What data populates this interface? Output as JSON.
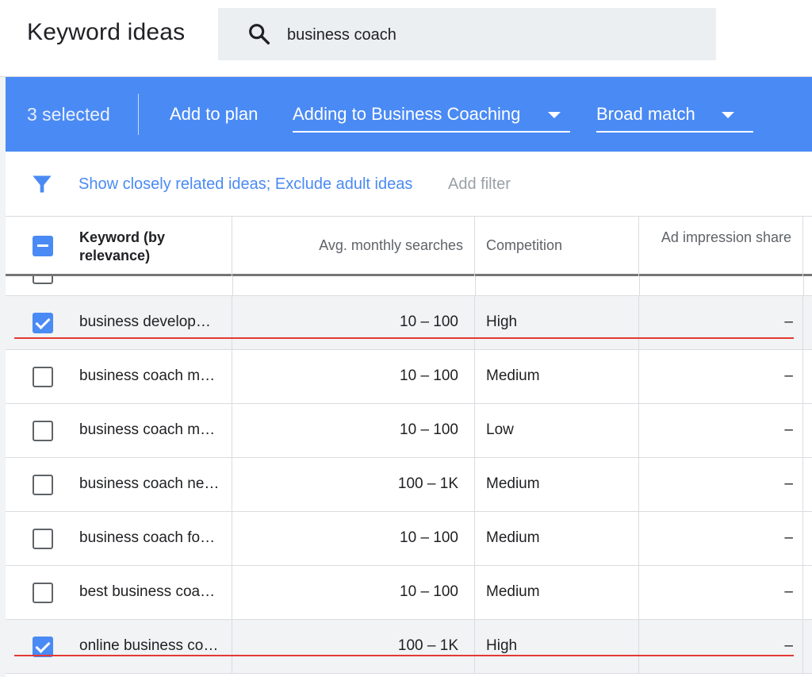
{
  "header": {
    "title": "Keyword ideas",
    "search": {
      "value": "business coach",
      "icon": "search-icon"
    }
  },
  "selection_bar": {
    "count_label": "3 selected",
    "add_to_plan": "Add to plan",
    "plan_dropdown": "Adding to Business Coaching",
    "match_dropdown": "Broad match",
    "background_color": "#4a8af4"
  },
  "filters": {
    "icon": "filter-icon",
    "active_filters": "Show closely related ideas; Exclude adult ideas",
    "add_filter": "Add filter"
  },
  "table": {
    "columns": {
      "keyword": "Keyword (by relevance)",
      "avg_monthly_searches": "Avg. monthly searches",
      "competition": "Competition",
      "ad_impression_share": "Ad impression share"
    },
    "rows": [
      {
        "checked": true,
        "keyword": "business develop…",
        "avg": "10 – 100",
        "competition": "High",
        "impression": "–"
      },
      {
        "checked": false,
        "keyword": "business coach m…",
        "avg": "10 – 100",
        "competition": "Medium",
        "impression": "–"
      },
      {
        "checked": false,
        "keyword": "business coach m…",
        "avg": "10 – 100",
        "competition": "Low",
        "impression": "–"
      },
      {
        "checked": false,
        "keyword": "business coach ne…",
        "avg": "100 – 1K",
        "competition": "Medium",
        "impression": "–"
      },
      {
        "checked": false,
        "keyword": "business coach fo…",
        "avg": "10 – 100",
        "competition": "Medium",
        "impression": "–"
      },
      {
        "checked": false,
        "keyword": "best business coa…",
        "avg": "10 – 100",
        "competition": "Medium",
        "impression": "–"
      },
      {
        "checked": true,
        "keyword": "online business co…",
        "avg": "100 – 1K",
        "competition": "High",
        "impression": "–"
      }
    ]
  },
  "colors": {
    "accent": "#4a8af4",
    "annotation": "#e53935",
    "selected_row": "#f1f3f4"
  }
}
